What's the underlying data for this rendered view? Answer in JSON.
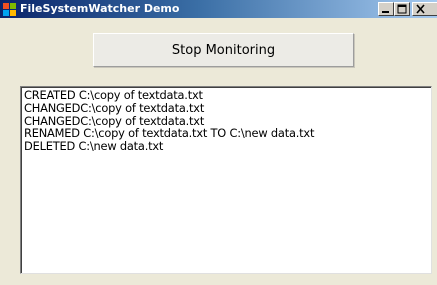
{
  "window": {
    "title": "FileSystemWatcher Demo",
    "title_bar_color": "#0a246a",
    "background_color": "#ece9d8"
  },
  "controls": {
    "stop_button_label": "Stop Monitoring"
  },
  "log": {
    "lines": [
      "CREATED C:\\copy of textdata.txt",
      "CHANGEDC:\\copy of textdata.txt",
      "CHANGEDC:\\copy of textdata.txt",
      "RENAMED C:\\copy of textdata.txt TO C:\\new data.txt",
      "DELETED C:\\new data.txt"
    ]
  },
  "icons": {
    "app": "windows-app-icon",
    "minimize": "minimize-icon",
    "maximize": "maximize-icon",
    "close": "close-icon"
  }
}
